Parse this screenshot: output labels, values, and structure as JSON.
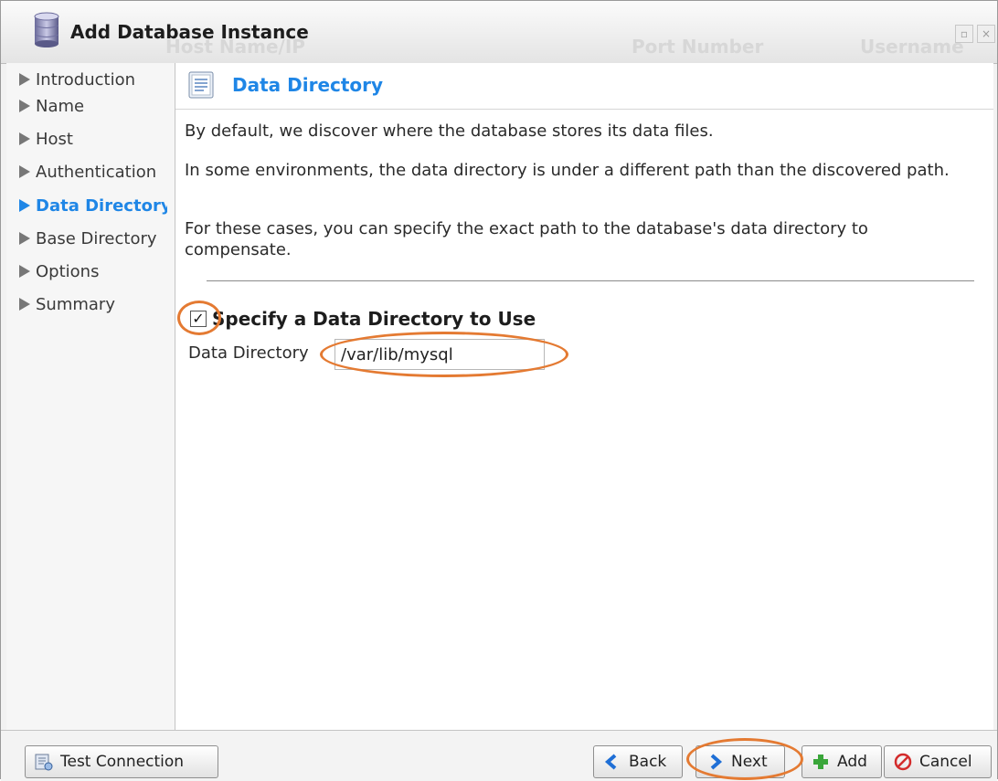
{
  "window": {
    "title": "Add Database Instance",
    "background_columns": [
      "Host Name/IP",
      "Port Number",
      "Username"
    ]
  },
  "sidebar": {
    "items": [
      {
        "label": "Introduction",
        "active": false
      },
      {
        "label": "Name",
        "active": false
      },
      {
        "label": "Host",
        "active": false
      },
      {
        "label": "Authentication",
        "active": false
      },
      {
        "label": "Data Directory",
        "active": true
      },
      {
        "label": "Base Directory",
        "active": false
      },
      {
        "label": "Options",
        "active": false
      },
      {
        "label": "Summary",
        "active": false
      }
    ]
  },
  "main": {
    "section_title": "Data Directory",
    "paragraphs": [
      "By default, we discover where the database stores its data files.",
      "In some environments, the data directory is under a different path than the discovered path.",
      "For these cases, you can specify the exact path to the database's data directory to compensate."
    ],
    "checkbox": {
      "label": "Specify a Data Directory to Use",
      "checked": true
    },
    "field": {
      "label": "Data Directory",
      "value": "/var/lib/mysql"
    }
  },
  "footer": {
    "test_connection": "Test Connection",
    "back": "Back",
    "next": "Next",
    "add": "Add",
    "cancel": "Cancel"
  },
  "colors": {
    "accent": "#1f86e6",
    "highlight": "#e47a32"
  }
}
